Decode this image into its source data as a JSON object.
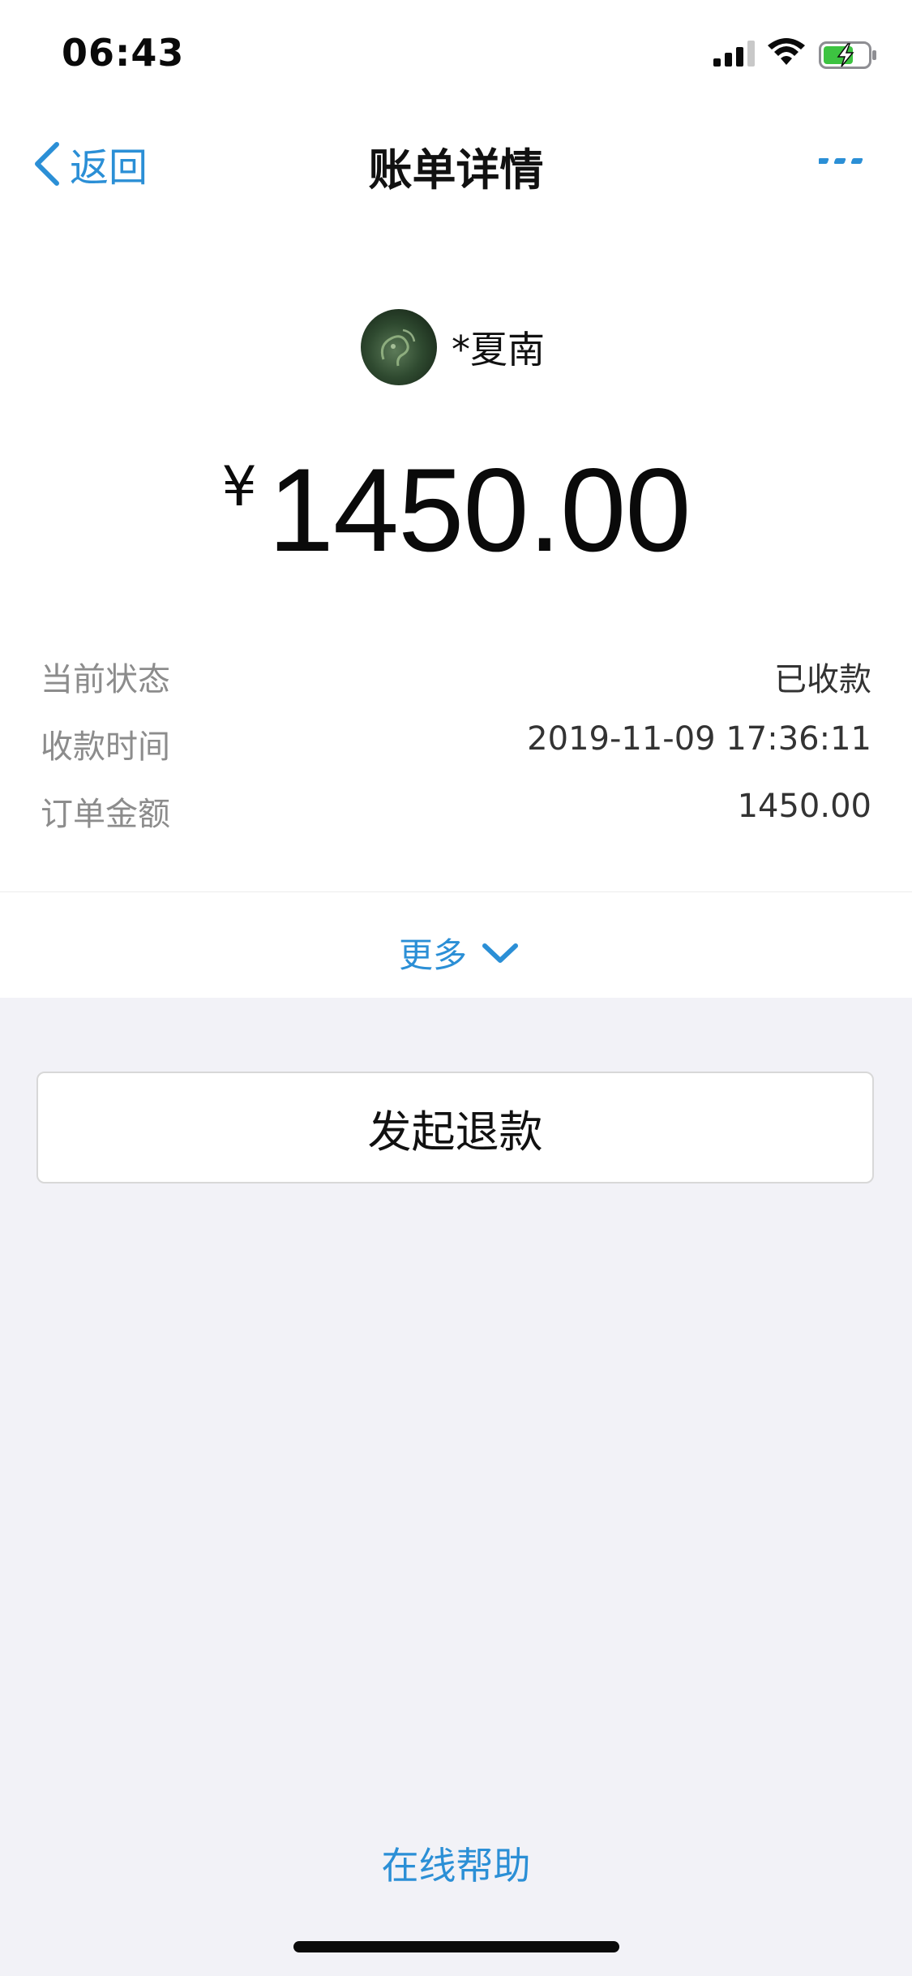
{
  "status_bar": {
    "time": "06:43",
    "signal_icon": "cellular-signal-icon",
    "wifi_icon": "wifi-icon",
    "battery_icon": "battery-charging-icon"
  },
  "nav": {
    "back_label": "返回",
    "back_icon": "chevron-left-icon",
    "title": "账单详情",
    "more_icon": "ellipsis-icon"
  },
  "payer": {
    "name": "*夏南",
    "avatar_icon": "avatar"
  },
  "amount": {
    "currency": "¥",
    "value": "1450.00"
  },
  "details": [
    {
      "label": "当前状态",
      "value": "已收款"
    },
    {
      "label": "收款时间",
      "value": "2019-11-09 17:36:11"
    },
    {
      "label": "订单金额",
      "value": "1450.00"
    }
  ],
  "more": {
    "label": "更多",
    "icon": "chevron-down-icon"
  },
  "refund_button": {
    "label": "发起退款"
  },
  "help": {
    "label": "在线帮助"
  },
  "colors": {
    "accent": "#2b8fd6",
    "background": "#f2f2f7",
    "card": "#ffffff",
    "label_gray": "#8c8c8c",
    "battery_green": "#3dc341"
  }
}
